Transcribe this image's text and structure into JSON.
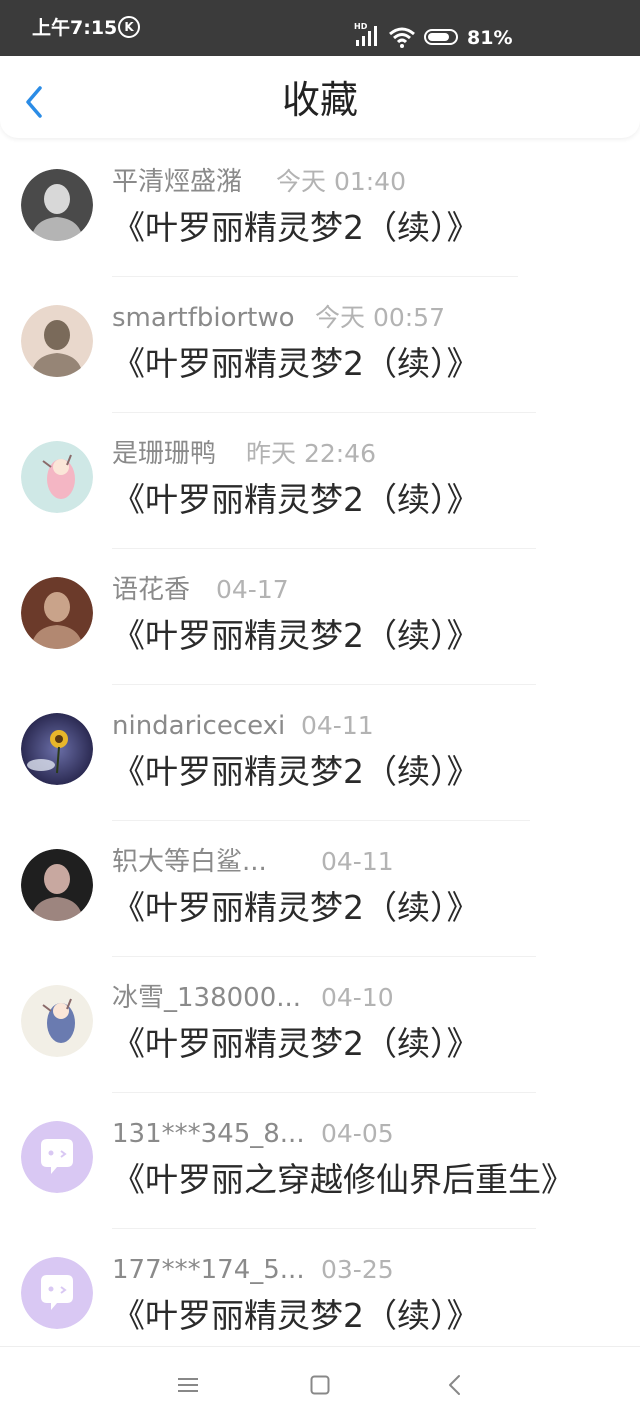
{
  "status_bar": {
    "time": "上午7:15",
    "k_badge": "K",
    "hd_label": "HD",
    "battery_percent": "81%",
    "battery_level": 0.81
  },
  "header": {
    "title": "收藏",
    "back_icon": "chevron-left-icon",
    "accent_color": "#2b8ce6"
  },
  "items": [
    {
      "author": "平清烴盛潴",
      "time": "今天 01:40",
      "book": "《叶罗丽精灵梦2（续）》",
      "avatar": "photo-avatar-icon"
    },
    {
      "author": "smartfbiortwo",
      "time": "今天 00:57",
      "book": "《叶罗丽精灵梦2（续）》",
      "avatar": "photo-avatar-icon"
    },
    {
      "author": "是珊珊鸭",
      "time": "昨天 22:46",
      "book": "《叶罗丽精灵梦2（续）》",
      "avatar": "illustration-avatar-icon"
    },
    {
      "author": "语花香",
      "time": "04-17",
      "book": "《叶罗丽精灵梦2（续）》",
      "avatar": "photo-avatar-icon"
    },
    {
      "author": "nindaricecexi",
      "time": "04-11",
      "book": "《叶罗丽精灵梦2（续）》",
      "avatar": "sunflower-avatar-icon"
    },
    {
      "author": "轵大等白鲨...",
      "time": "04-11",
      "book": "《叶罗丽精灵梦2（续）》",
      "avatar": "photo-avatar-icon"
    },
    {
      "author": "冰雪_138000...",
      "time": "04-10",
      "book": "《叶罗丽精灵梦2（续）》",
      "avatar": "illustration-avatar-icon"
    },
    {
      "author": "131***345_8...",
      "time": "04-05",
      "book": "《叶罗丽之穿越修仙界后重生》",
      "avatar": "default-chat-avatar-icon"
    },
    {
      "author": "177***174_5...",
      "time": "03-25",
      "book": "《叶罗丽精灵梦2（续）》",
      "avatar": "default-chat-avatar-icon"
    }
  ],
  "navbar": {
    "menu_icon": "menu-icon",
    "home_icon": "home-square-icon",
    "back_icon": "back-triangle-icon"
  }
}
